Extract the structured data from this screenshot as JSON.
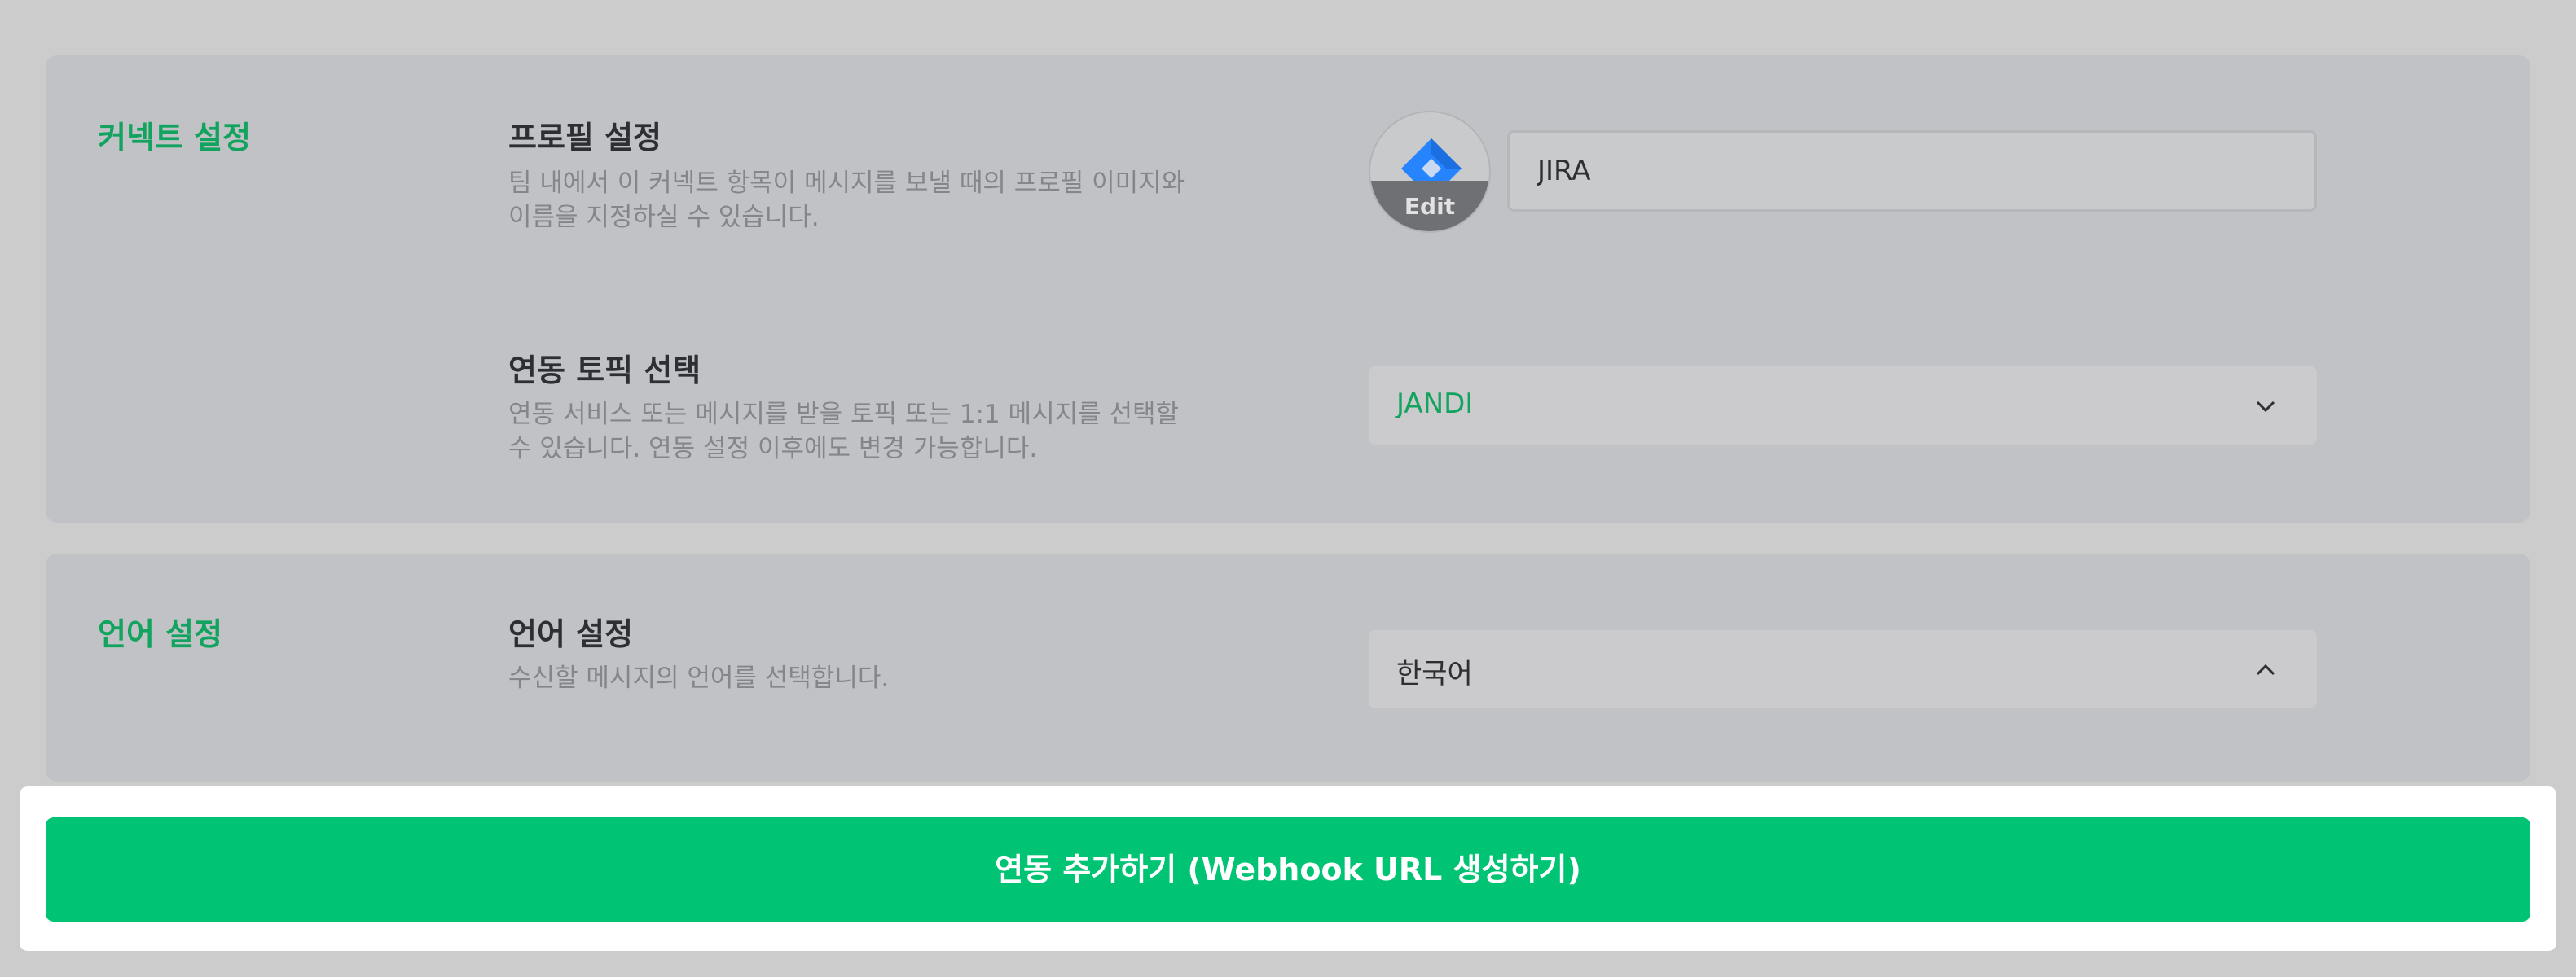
{
  "connect_section": {
    "title": "커넥트 설정",
    "profile": {
      "title": "프로필 설정",
      "description": "팀 내에서 이 커넥트 항목이 메시지를 보낼 때의 프로필 이미지와 이름을 지정하실 수 있습니다.",
      "avatar_icon": "jira-logo-icon",
      "edit_label": "Edit",
      "name_value": "JIRA"
    },
    "topic": {
      "title": "연동 토픽 선택",
      "description": "연동 서비스 또는 메시지를 받을 토픽 또는 1:1 메시지를 선택할 수 있습니다. 연동 설정 이후에도 변경 가능합니다.",
      "selected": "JANDI",
      "icon": "chevron-down-icon"
    }
  },
  "language_section": {
    "title": "언어 설정",
    "row_title": "언어 설정",
    "description": "수신할 메시지의 언어를 선택합니다.",
    "selected": "한국어",
    "icon": "chevron-up-icon"
  },
  "action": {
    "button_label": "연동 추가하기 (Webhook URL 생성하기)"
  },
  "colors": {
    "accent_green": "#12a45e",
    "button_green": "#00c473",
    "jira_blue": "#2684ff"
  }
}
